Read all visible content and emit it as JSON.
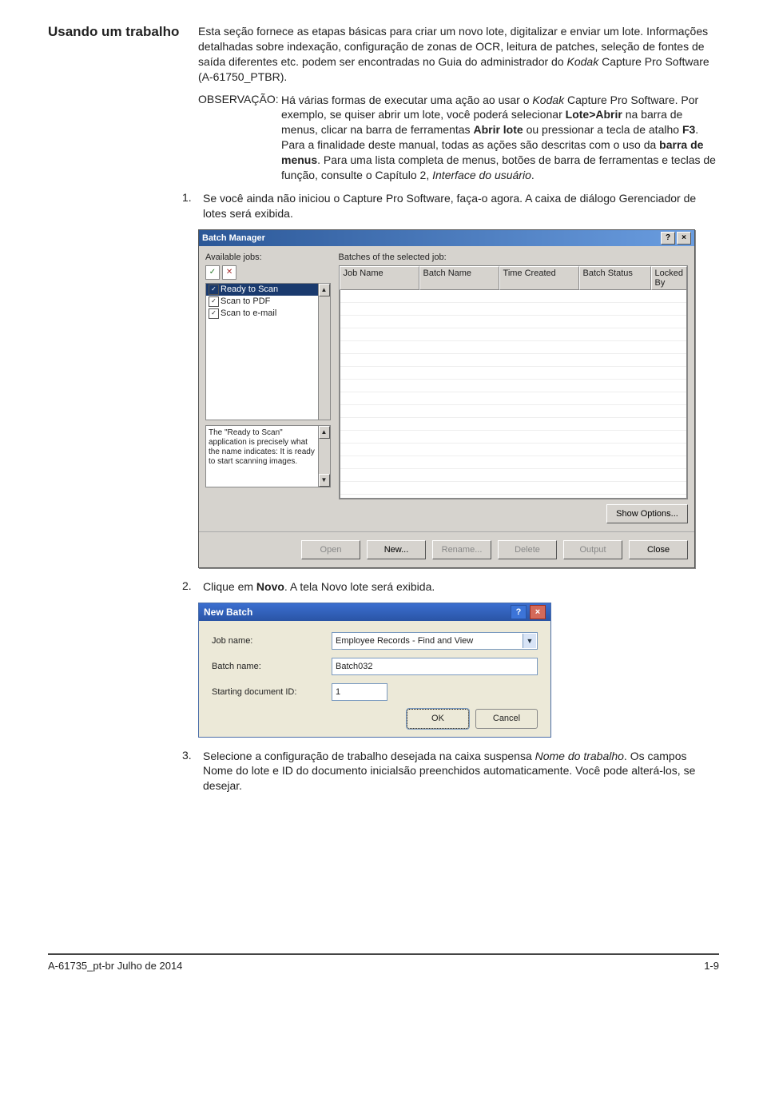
{
  "heading": "Usando um trabalho",
  "para1_a": "Esta seção fornece as etapas básicas para criar um novo lote, digitalizar e enviar um lote. Informações detalhadas sobre indexação, configuração de zonas de OCR, leitura de patches, seleção de fontes de saída diferentes etc. podem ser encontradas no Guia do administrador do ",
  "para1_i": "Kodak",
  "para1_b": " Capture Pro Software (A-61750_PTBR).",
  "obs_label": "OBSERVAÇÃO: ",
  "obs_a": "Há várias formas de executar uma ação ao usar o ",
  "obs_i1": "Kodak",
  "obs_b": " Capture Pro Software. Por exemplo, se quiser abrir um lote, você poderá selecionar ",
  "obs_bold1": "Lote>Abrir",
  "obs_c": " na barra de menus, clicar na barra de ferramentas ",
  "obs_bold2": "Abrir lote",
  "obs_d": " ou pressionar a tecla de atalho ",
  "obs_bold3": "F3",
  "obs_e": ". Para a finalidade deste manual, todas as ações são descritas com o uso da ",
  "obs_bold4": "barra de menus",
  "obs_f": ". Para uma lista completa de menus, botões de barra de ferramentas e teclas de função, consulte o Capítulo 2, ",
  "obs_i2": "Interface do usuário",
  "obs_g": ".",
  "step1_num": "1.",
  "step1_txt": "Se você ainda não iniciou o Capture Pro Software, faça-o agora. A caixa de diálogo Gerenciador de lotes será exibida.",
  "step2_num": "2.",
  "step2_a": "Clique em ",
  "step2_bold": "Novo",
  "step2_b": ". A tela Novo lote será exibida.",
  "step3_num": "3.",
  "step3_a": "Selecione a configuração de trabalho desejada na caixa suspensa ",
  "step3_i": "Nome do trabalho",
  "step3_b": ". Os campos Nome do lote e ID do documento inicialsão preenchidos automaticamente. Você pode alterá-los, se desejar.",
  "bm": {
    "title": "Batch Manager",
    "help_glyph": "?",
    "close_glyph": "×",
    "available_label": "Available jobs:",
    "ico_check": "✓",
    "ico_x": "✕",
    "jobs": [
      "Ready to Scan",
      "Scan to PDF",
      "Scan to e-mail"
    ],
    "desc": "The \"Ready to Scan\" application is precisely what the name indicates: It is ready to start scanning images.",
    "batches_label": "Batches of the selected job:",
    "cols": [
      "Job Name",
      "Batch Name",
      "Time Created",
      "Batch Status",
      "Locked By"
    ],
    "show_options": "Show Options...",
    "btns": [
      "Open",
      "New...",
      "Rename...",
      "Delete",
      "Output",
      "Close"
    ]
  },
  "nb": {
    "title": "New Batch",
    "help_glyph": "?",
    "close_glyph": "×",
    "job_label": "Job name:",
    "job_value": "Employee Records - Find and View",
    "batch_label": "Batch name:",
    "batch_value": "Batch032",
    "start_label": "Starting document ID:",
    "start_value": "1",
    "ok": "OK",
    "cancel": "Cancel"
  },
  "footer_left": "A-61735_pt-br  Julho de 2014",
  "footer_right": "1-9"
}
